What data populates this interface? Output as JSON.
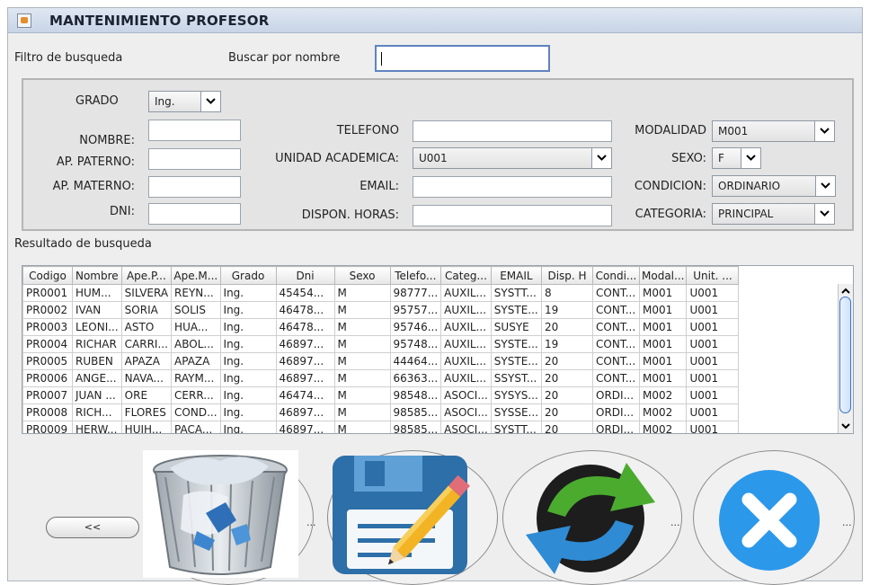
{
  "window": {
    "title": "MANTENIMIENTO PROFESOR"
  },
  "filter": {
    "label": "Filtro de busqueda",
    "search_label": "Buscar por nombre",
    "search_value": ""
  },
  "form": {
    "grado_label": "GRADO",
    "grado_value": "Ing.",
    "nombre_label": "NOMBRE:",
    "ap_paterno_label": "AP. PATERNO:",
    "ap_materno_label": "AP. MATERNO:",
    "dni_label": "DNI:",
    "telefono_label": "TELEFONO",
    "unidad_label": "UNIDAD ACADEMICA:",
    "unidad_value": "U001",
    "email_label": "EMAIL:",
    "dispon_label": "DISPON. HORAS:",
    "modalidad_label": "MODALIDAD",
    "modalidad_value": "M001",
    "sexo_label": "SEXO:",
    "sexo_value": "F",
    "condicion_label": "CONDICION:",
    "condicion_value": "ORDINARIO",
    "categoria_label": "CATEGORIA:",
    "categoria_value": "PRINCIPAL"
  },
  "results": {
    "label": "Resultado de busqueda",
    "columns": [
      "Codigo",
      "Nombre",
      "Ape.P...",
      "Ape.M...",
      "Grado",
      "Dni",
      "Sexo",
      "Telefo...",
      "Categ...",
      "EMAIL",
      "Disp. H",
      "Condi...",
      "Modal...",
      "Unit. ..."
    ],
    "rows": [
      [
        "PR0001",
        "HUM...",
        "SILVERA",
        "REYN...",
        "Ing.",
        "45454...",
        "M",
        "98777...",
        "AUXIL...",
        "SYSTT...",
        "8",
        "CONT...",
        "M001",
        "U001"
      ],
      [
        "PR0002",
        "IVAN",
        "SORIA",
        "SOLIS",
        "Ing.",
        "46478...",
        "M",
        "95757...",
        "AUXIL...",
        "SYSTE...",
        "19",
        "CONT...",
        "M001",
        "U001"
      ],
      [
        "PR0003",
        "LEONI...",
        "ASTO",
        "HUA...",
        "Ing.",
        "46478...",
        "M",
        "95746...",
        "AUXIL...",
        "SUSYE",
        "20",
        "CONT...",
        "M001",
        "U001"
      ],
      [
        "PR0004",
        "RICHAR",
        "CARRI...",
        "ABOL...",
        "Ing.",
        "46897...",
        "M",
        "95748...",
        "AUXIL...",
        "SYSTE...",
        "19",
        "CONT...",
        "M001",
        "U001"
      ],
      [
        "PR0005",
        "RUBEN",
        "APAZA",
        "APAZA",
        "Ing.",
        "46897...",
        "M",
        "44464...",
        "AUXIL...",
        "SYSTE...",
        "20",
        "CONT...",
        "M001",
        "U001"
      ],
      [
        "PR0006",
        "ANGE...",
        "NAVA...",
        "RAYM...",
        "Ing.",
        "46897...",
        "M",
        "66363...",
        "AUXIL...",
        "SSYST...",
        "20",
        "CONT...",
        "M001",
        "U001"
      ],
      [
        "PR0007",
        "JUAN ...",
        "ORE",
        "CERR...",
        "Ing.",
        "46474...",
        "M",
        "98548...",
        "ASOCI...",
        "SYSYS...",
        "20",
        "ORDI...",
        "M002",
        "U001"
      ],
      [
        "PR0008",
        "RICH...",
        "FLORES",
        "COND...",
        "Ing.",
        "46897...",
        "M",
        "98585...",
        "ASOCI...",
        "SYSSE...",
        "20",
        "ORDI...",
        "M002",
        "U001"
      ],
      [
        "PR0009",
        "HERW...",
        "HUIH...",
        "PACA...",
        "Ing.",
        "46897...",
        "M",
        "98585...",
        "ASOCI...",
        "SYSTT...",
        "20",
        "ORDI...",
        "M002",
        "U001"
      ]
    ]
  },
  "buttons": {
    "back_label": "<<",
    "dots": "..."
  },
  "icons": {
    "delete": "recycle-bin-icon",
    "save": "floppy-disk-edit-icon",
    "refresh": "refresh-arrows-icon",
    "cancel": "close-icon"
  }
}
